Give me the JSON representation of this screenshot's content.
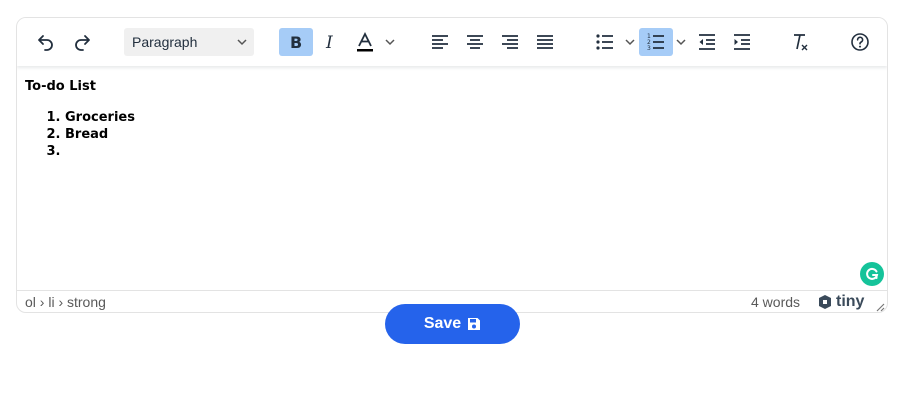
{
  "toolbar": {
    "undo_icon": "undo-icon",
    "redo_icon": "redo-icon",
    "block_format": "Paragraph",
    "bold_active": true,
    "numbered_list_active": true,
    "text_color": "#000000"
  },
  "document": {
    "heading": "To-do List",
    "list_items": [
      "Groceries",
      "Bread",
      ""
    ]
  },
  "statusbar": {
    "path": "ol › li › strong",
    "word_count": "4 words",
    "brand": "tiny"
  },
  "save_button": {
    "label": "Save",
    "icon": "floppy-disk-icon"
  },
  "colors": {
    "accent": "#2563eb",
    "active_button": "#a6ccf7",
    "grammarly": "#15c39a"
  }
}
